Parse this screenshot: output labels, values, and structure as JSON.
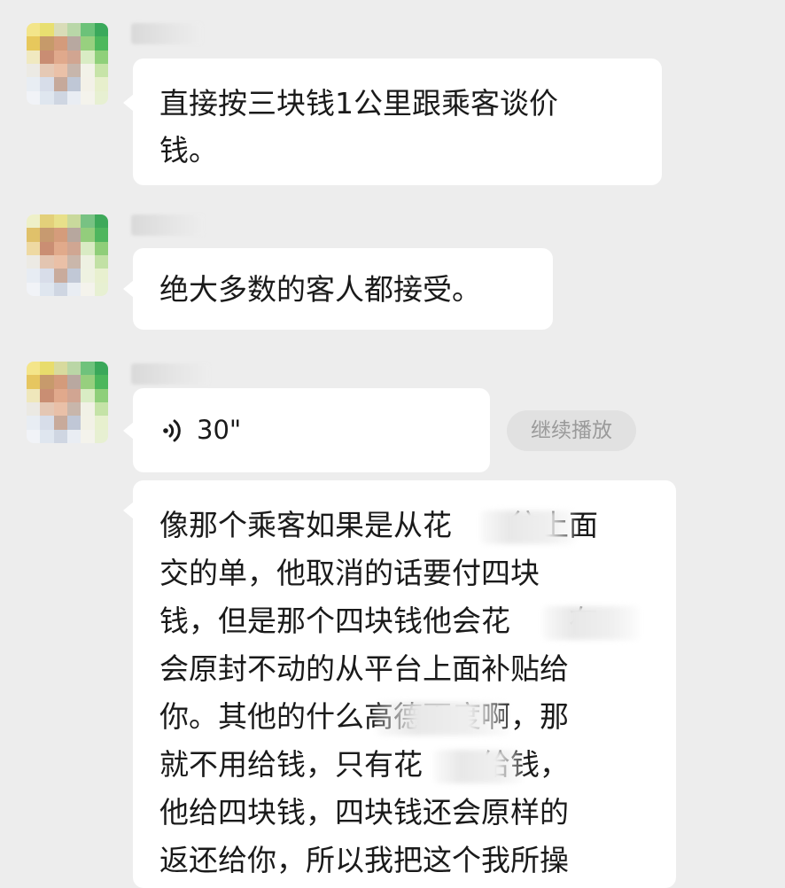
{
  "messages": [
    {
      "type": "text",
      "text": "直接按三块钱1公里跟乘客谈价钱。",
      "lines": [
        "直接按三块钱1公里跟乘客谈价",
        "钱。"
      ]
    },
    {
      "type": "text",
      "text": "绝大多数的客人都接受。"
    },
    {
      "type": "voice",
      "duration": "30\"",
      "action": "继续播放"
    },
    {
      "type": "text",
      "lines": [
        "像那个乘客如果是从花　　往上面",
        "交的单，他取消的话要付四块",
        "钱，但是那个四块钱他会花　　在",
        "会原封不动的从平台上面补贴给",
        "你。其他的什么高德百度啊，那",
        "就不用给钱，只有花　　给钱，",
        "他给四块钱，四块钱还会原样的",
        "返还给你，所以我把这个我所操"
      ]
    }
  ],
  "icons": {
    "voice": "voice-wave-icon"
  },
  "colors": {
    "background": "#ededed",
    "bubble": "#ffffff",
    "button": "#e1e1e1"
  }
}
